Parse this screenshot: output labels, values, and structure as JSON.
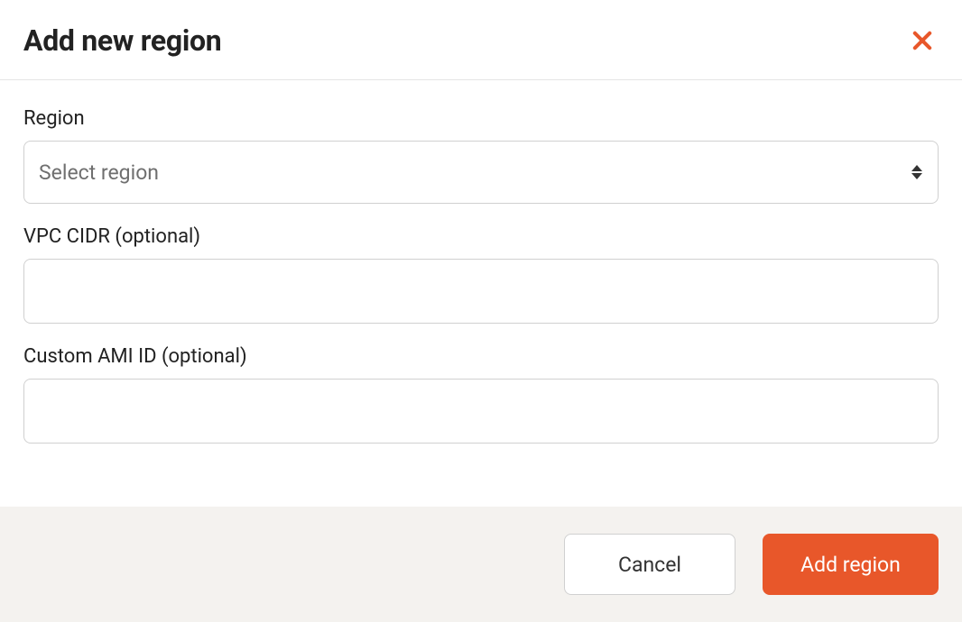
{
  "modal": {
    "title": "Add new region"
  },
  "form": {
    "region": {
      "label": "Region",
      "placeholder": "Select region"
    },
    "vpc_cidr": {
      "label": "VPC CIDR (optional)",
      "value": ""
    },
    "custom_ami": {
      "label": "Custom AMI ID (optional)",
      "value": ""
    }
  },
  "footer": {
    "cancel_label": "Cancel",
    "submit_label": "Add region"
  },
  "colors": {
    "accent": "#e8572a",
    "footer_bg": "#f4f2ef",
    "border": "#d0d0d0"
  }
}
